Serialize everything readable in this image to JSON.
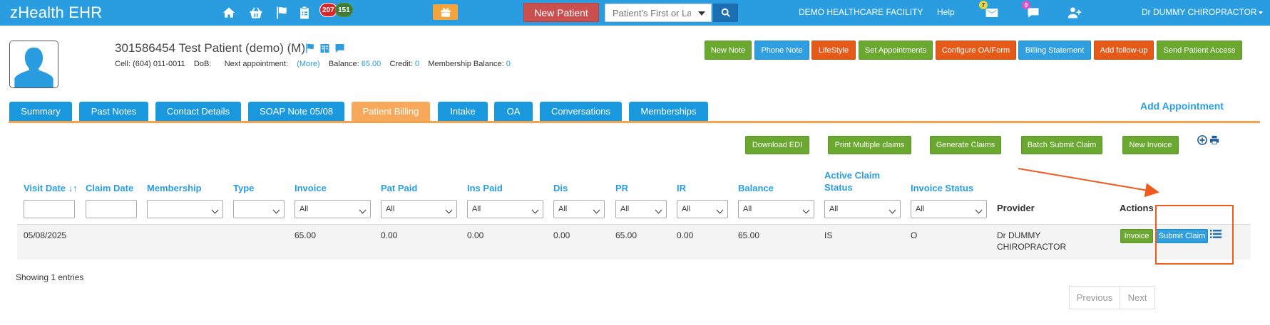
{
  "app": {
    "title": "zHealth EHR"
  },
  "topbar": {
    "icons": [
      "home-icon",
      "basket-icon",
      "flag-icon",
      "clipboard-icon"
    ],
    "badge_red": "207",
    "badge_green": "151",
    "new_patient_label": "New Patient",
    "search_placeholder": "Patient's First or La",
    "facility": "DEMO HEALTHCARE FACILITY",
    "help": "Help",
    "mail_count": "7",
    "chat_count": "0",
    "user": "Dr DUMMY CHIROPRACTOR"
  },
  "patient": {
    "name": "301586454 Test Patient  (demo) (M)",
    "cell_label": "Cell:",
    "cell": "(604) 011-0011",
    "dob_label": "DoB:",
    "next_appt_label": "Next appointment:",
    "more": "(More)",
    "balance_label": "Balance:",
    "balance": "65.00",
    "credit_label": "Credit:",
    "credit": "0",
    "membership_label": "Membership Balance:",
    "membership": "0"
  },
  "header_buttons": [
    "New Note",
    "Phone Note",
    "LifeStyle",
    "Set Appointments",
    "Configure OA/Form",
    "Billing Statement",
    "Add follow-up",
    "Send Patient Access"
  ],
  "tabs": [
    "Summary",
    "Past Notes",
    "Contact Details",
    "SOAP Note 05/08",
    "Patient Billing",
    "Intake",
    "OA",
    "Conversations",
    "Memberships"
  ],
  "active_tab": "Patient Billing",
  "add_appointment": "Add Appointment",
  "action_buttons": [
    "Download EDI",
    "Print Multiple claims",
    "Generate Claims",
    "Batch Submit Claim",
    "New Invoice"
  ],
  "columns": {
    "visit_date": "Visit Date",
    "claim_date": "Claim Date",
    "membership": "Membership",
    "type": "Type",
    "invoice": "Invoice",
    "pat_paid": "Pat Paid",
    "ins_paid": "Ins Paid",
    "dis": "Dis",
    "pr": "PR",
    "ir": "IR",
    "balance": "Balance",
    "active_claim_1": "Active Claim",
    "active_claim_2": "Status",
    "invoice_status": "Invoice Status",
    "provider": "Provider",
    "actions": "Actions"
  },
  "filter_all": "All",
  "row": {
    "visit_date": "05/08/2025",
    "invoice": "65.00",
    "pat_paid": "0.00",
    "ins_paid": "0.00",
    "dis": "0.00",
    "pr": "65.00",
    "ir": "0.00",
    "balance": "65.00",
    "claim_status": "IS",
    "invoice_status": "O",
    "provider_1": "Dr DUMMY",
    "provider_2": "CHIROPRACTOR",
    "invoice_btn": "Invoice",
    "submit_btn": "Submit Claim"
  },
  "showing": "Showing 1 entries",
  "pager": {
    "previous": "Previous",
    "next": "Next"
  },
  "colors": {
    "topbar": "#2a9de0",
    "green": "#6aa82f",
    "orange": "#e55a18",
    "tab_active": "#f8a85a",
    "annotation": "#f05a1a"
  }
}
